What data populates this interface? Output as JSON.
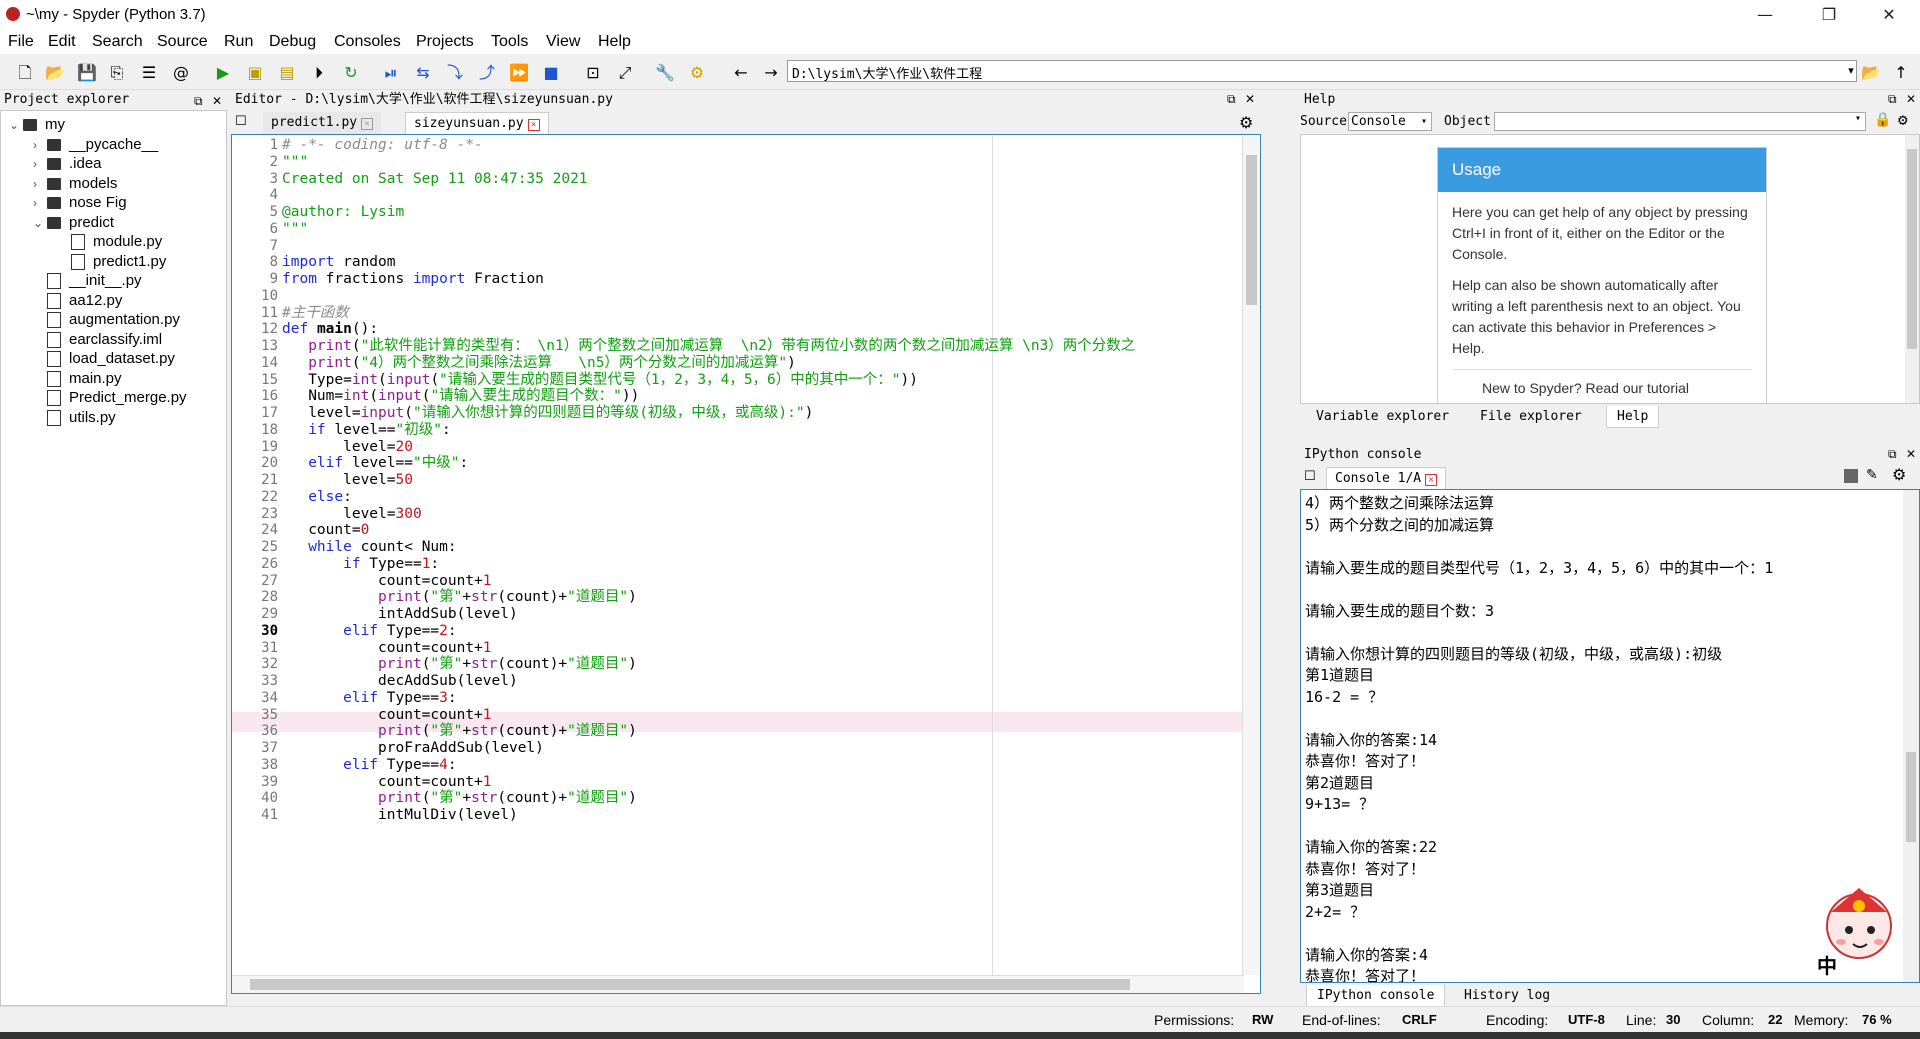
{
  "window": {
    "title": "~\\my - Spyder (Python 3.7)",
    "min": "—",
    "max": "❐",
    "close": "✕"
  },
  "menu": [
    "File",
    "Edit",
    "Search",
    "Source",
    "Run",
    "Debug",
    "Consoles",
    "Projects",
    "Tools",
    "View",
    "Help"
  ],
  "toolbar": {
    "path": "D:\\lysim\\大学\\作业\\软件工程"
  },
  "project": {
    "header": "Project explorer",
    "items": [
      {
        "label": "my",
        "type": "folder",
        "indent": 0,
        "chev": "v"
      },
      {
        "label": "__pycache__",
        "type": "folder",
        "indent": 1,
        "chev": ">"
      },
      {
        "label": ".idea",
        "type": "folder",
        "indent": 1,
        "chev": ">"
      },
      {
        "label": "models",
        "type": "folder",
        "indent": 1,
        "chev": ">"
      },
      {
        "label": "nose Fig",
        "type": "folder",
        "indent": 1,
        "chev": ">"
      },
      {
        "label": "predict",
        "type": "folder",
        "indent": 1,
        "chev": "v"
      },
      {
        "label": "module.py",
        "type": "file",
        "indent": 2,
        "chev": ""
      },
      {
        "label": "predict1.py",
        "type": "file",
        "indent": 2,
        "chev": ""
      },
      {
        "label": "__init__.py",
        "type": "file",
        "indent": 1,
        "chev": ""
      },
      {
        "label": "aa12.py",
        "type": "file",
        "indent": 1,
        "chev": ""
      },
      {
        "label": "augmentation.py",
        "type": "file",
        "indent": 1,
        "chev": ""
      },
      {
        "label": "earclassify.iml",
        "type": "file",
        "indent": 1,
        "chev": ""
      },
      {
        "label": "load_dataset.py",
        "type": "file",
        "indent": 1,
        "chev": ""
      },
      {
        "label": "main.py",
        "type": "file",
        "indent": 1,
        "chev": ""
      },
      {
        "label": "Predict_merge.py",
        "type": "file",
        "indent": 1,
        "chev": ""
      },
      {
        "label": "utils.py",
        "type": "file",
        "indent": 1,
        "chev": ""
      }
    ]
  },
  "editor": {
    "header": "Editor - D:\\lysim\\大学\\作业\\软件工程\\sizeyunsuan.py",
    "tabs": [
      {
        "label": "predict1.py"
      },
      {
        "label": "sizeyunsuan.py"
      }
    ],
    "current_line": 30,
    "lines": [
      [
        [
          "cm",
          "# -*- coding: utf-8 -*-"
        ]
      ],
      [
        [
          "str",
          "\"\"\""
        ]
      ],
      [
        [
          "str",
          "Created on Sat Sep 11 08:47:35 2021"
        ]
      ],
      [
        [
          "str",
          ""
        ]
      ],
      [
        [
          "str",
          "@author: Lysim"
        ]
      ],
      [
        [
          "str",
          "\"\"\""
        ]
      ],
      [
        [
          "",
          ""
        ]
      ],
      [
        [
          "kw",
          "import"
        ],
        [
          "",
          " random"
        ]
      ],
      [
        [
          "kw",
          "from"
        ],
        [
          "",
          " fractions "
        ],
        [
          "kw",
          "import"
        ],
        [
          "",
          " Fraction"
        ]
      ],
      [
        [
          "",
          ""
        ]
      ],
      [
        [
          "cm",
          "#主干函数"
        ]
      ],
      [
        [
          "kw",
          "def"
        ],
        [
          "",
          " "
        ],
        [
          "bold",
          "main"
        ],
        [
          "",
          "():"
        ]
      ],
      [
        [
          "",
          " "
        ],
        [
          "bi",
          "print"
        ],
        [
          "",
          "("
        ],
        [
          "str",
          "\"此软件能计算的类型有： \\n1）两个整数之间加减运算  \\n2）带有两位小数的两个数之间加减运算 \\n3）两个分数之"
        ]
      ],
      [
        [
          "",
          " "
        ],
        [
          "bi",
          "print"
        ],
        [
          "",
          "("
        ],
        [
          "str",
          "\"4）两个整数之间乘除法运算   \\n5）两个分数之间的加减运算\""
        ],
        [
          "",
          ")"
        ]
      ],
      [
        [
          "",
          " Type="
        ],
        [
          "bi",
          "int"
        ],
        [
          "",
          "("
        ],
        [
          "bi",
          "input"
        ],
        [
          "",
          "("
        ],
        [
          "str",
          "\"请输入要生成的题目类型代号（1，2，3，4，5，6）中的其中一个：\""
        ],
        [
          "",
          "))"
        ]
      ],
      [
        [
          "",
          " Num="
        ],
        [
          "bi",
          "int"
        ],
        [
          "",
          "("
        ],
        [
          "bi",
          "input"
        ],
        [
          "",
          "("
        ],
        [
          "str",
          "\"请输入要生成的题目个数：\""
        ],
        [
          "",
          "))"
        ]
      ],
      [
        [
          "",
          " level="
        ],
        [
          "bi",
          "input"
        ],
        [
          "",
          "("
        ],
        [
          "str",
          "\"请输入你想计算的四则题目的等级(初级，中级，或高级):\""
        ],
        [
          "",
          ")"
        ]
      ],
      [
        [
          "",
          " "
        ],
        [
          "kw",
          "if"
        ],
        [
          "",
          " level=="
        ],
        [
          "str",
          "\"初级\""
        ],
        [
          "",
          ":"
        ]
      ],
      [
        [
          "",
          "     level="
        ],
        [
          "num",
          "20"
        ]
      ],
      [
        [
          "",
          " "
        ],
        [
          "kw",
          "elif"
        ],
        [
          "",
          " level=="
        ],
        [
          "str",
          "\"中级\""
        ],
        [
          "",
          ":"
        ]
      ],
      [
        [
          "",
          "     level="
        ],
        [
          "num",
          "50"
        ]
      ],
      [
        [
          "",
          " "
        ],
        [
          "kw",
          "else"
        ],
        [
          "",
          ":"
        ]
      ],
      [
        [
          "",
          "     level="
        ],
        [
          "num",
          "300"
        ]
      ],
      [
        [
          "",
          " count="
        ],
        [
          "num",
          "0"
        ]
      ],
      [
        [
          "",
          " "
        ],
        [
          "kw",
          "while"
        ],
        [
          "",
          " count< Num:"
        ]
      ],
      [
        [
          "",
          "     "
        ],
        [
          "kw",
          "if"
        ],
        [
          "",
          " Type=="
        ],
        [
          "num",
          "1"
        ],
        [
          "",
          ":"
        ]
      ],
      [
        [
          "",
          "         count=count+"
        ],
        [
          "num",
          "1"
        ]
      ],
      [
        [
          "",
          "         "
        ],
        [
          "bi",
          "print"
        ],
        [
          "",
          "("
        ],
        [
          "str",
          "\"第\""
        ],
        [
          "",
          "+"
        ],
        [
          "bi",
          "str"
        ],
        [
          "",
          "(count)+"
        ],
        [
          "str",
          "\"道题目\""
        ],
        [
          "",
          ")"
        ]
      ],
      [
        [
          "",
          "         intAddSub(level)"
        ]
      ],
      [
        [
          "",
          "     "
        ],
        [
          "kw",
          "elif"
        ],
        [
          "",
          " Type=="
        ],
        [
          "num",
          "2"
        ],
        [
          "",
          ":"
        ]
      ],
      [
        [
          "",
          "         count=count+"
        ],
        [
          "num",
          "1"
        ]
      ],
      [
        [
          "",
          "         "
        ],
        [
          "bi",
          "print"
        ],
        [
          "",
          "("
        ],
        [
          "str",
          "\"第\""
        ],
        [
          "",
          "+"
        ],
        [
          "bi",
          "str"
        ],
        [
          "",
          "(count)+"
        ],
        [
          "str",
          "\"道题目\""
        ],
        [
          "",
          ")"
        ]
      ],
      [
        [
          "",
          "         decAddSub(level)"
        ]
      ],
      [
        [
          "",
          "     "
        ],
        [
          "kw",
          "elif"
        ],
        [
          "",
          " Type=="
        ],
        [
          "num",
          "3"
        ],
        [
          "",
          ":"
        ]
      ],
      [
        [
          "",
          "         count=count+"
        ],
        [
          "num",
          "1"
        ]
      ],
      [
        [
          "",
          "         "
        ],
        [
          "bi",
          "print"
        ],
        [
          "",
          "("
        ],
        [
          "str",
          "\"第\""
        ],
        [
          "",
          "+"
        ],
        [
          "bi",
          "str"
        ],
        [
          "",
          "(count)+"
        ],
        [
          "str",
          "\"道题目\""
        ],
        [
          "",
          ")"
        ]
      ],
      [
        [
          "",
          "         proFraAddSub(level)"
        ]
      ],
      [
        [
          "",
          "     "
        ],
        [
          "kw",
          "elif"
        ],
        [
          "",
          " Type=="
        ],
        [
          "num",
          "4"
        ],
        [
          "",
          ":"
        ]
      ],
      [
        [
          "",
          "         count=count+"
        ],
        [
          "num",
          "1"
        ]
      ],
      [
        [
          "",
          "         "
        ],
        [
          "bi",
          "print"
        ],
        [
          "",
          "("
        ],
        [
          "str",
          "\"第\""
        ],
        [
          "",
          "+"
        ],
        [
          "bi",
          "str"
        ],
        [
          "",
          "(count)+"
        ],
        [
          "str",
          "\"道题目\""
        ],
        [
          "",
          ")"
        ]
      ],
      [
        [
          "",
          "         intMulDiv(level)"
        ]
      ]
    ]
  },
  "help": {
    "header": "Help",
    "source_label": "Source",
    "source_value": "Console",
    "object_label": "Object",
    "usage_title": "Usage",
    "usage_p1": "Here you can get help of any object by pressing Ctrl+I in front of it, either on the Editor or the Console.",
    "usage_p2": "Help can also be shown automatically after writing a left parenthesis next to an object. You can activate this behavior in Preferences > Help.",
    "usage_p3": "New to Spyder? Read our tutorial",
    "tabs": [
      "Variable explorer",
      "File explorer",
      "Help"
    ]
  },
  "console": {
    "header": "IPython console",
    "tab": "Console 1/A",
    "lines": [
      "4）两个整数之间乘除法运算",
      "5）两个分数之间的加减运算",
      "",
      "请输入要生成的题目类型代号（1，2，3，4，5，6）中的其中一个：1",
      "",
      "请输入要生成的题目个数：3",
      "",
      "请输入你想计算的四则题目的等级(初级，中级，或高级):初级",
      "第1道题目",
      "16-2 = ？",
      "",
      "请输入你的答案:14",
      "恭喜你！答对了！",
      "第2道题目",
      "9+13= ？",
      "",
      "请输入你的答案:22",
      "恭喜你！答对了！",
      "第3道题目",
      "2+2= ？",
      "",
      "请输入你的答案:4",
      "恭喜你！答对了！"
    ],
    "tabs": [
      "IPython console",
      "History log"
    ]
  },
  "status": {
    "permissions_label": "Permissions:",
    "permissions": "RW",
    "eol_label": "End-of-lines:",
    "eol": "CRLF",
    "enc_label": "Encoding:",
    "enc": "UTF-8",
    "line_label": "Line:",
    "line": "30",
    "col_label": "Column:",
    "col": "22",
    "mem_label": "Memory:",
    "mem": "76 %"
  },
  "ime": {
    "label": "中"
  }
}
